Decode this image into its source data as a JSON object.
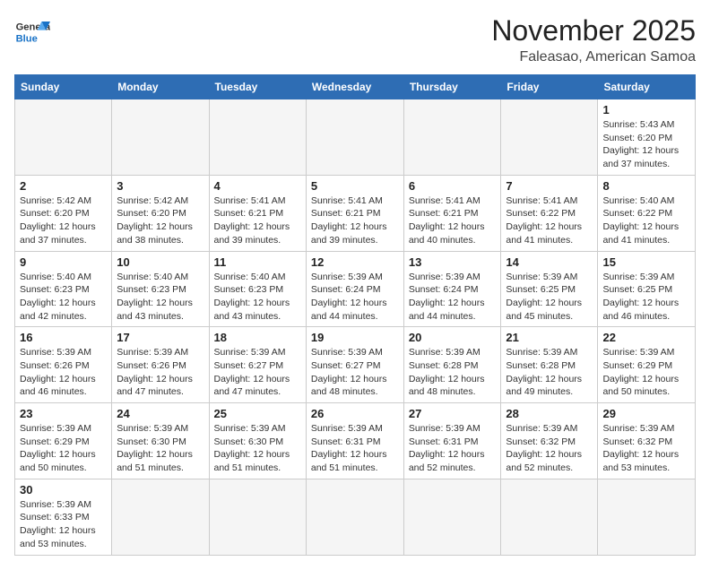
{
  "header": {
    "logo_line1": "General",
    "logo_line2": "Blue",
    "month": "November 2025",
    "location": "Faleasao, American Samoa"
  },
  "weekdays": [
    "Sunday",
    "Monday",
    "Tuesday",
    "Wednesday",
    "Thursday",
    "Friday",
    "Saturday"
  ],
  "weeks": [
    [
      {
        "day": "",
        "info": ""
      },
      {
        "day": "",
        "info": ""
      },
      {
        "day": "",
        "info": ""
      },
      {
        "day": "",
        "info": ""
      },
      {
        "day": "",
        "info": ""
      },
      {
        "day": "",
        "info": ""
      },
      {
        "day": "1",
        "info": "Sunrise: 5:43 AM\nSunset: 6:20 PM\nDaylight: 12 hours and 37 minutes."
      }
    ],
    [
      {
        "day": "2",
        "info": "Sunrise: 5:42 AM\nSunset: 6:20 PM\nDaylight: 12 hours and 37 minutes."
      },
      {
        "day": "3",
        "info": "Sunrise: 5:42 AM\nSunset: 6:20 PM\nDaylight: 12 hours and 38 minutes."
      },
      {
        "day": "4",
        "info": "Sunrise: 5:41 AM\nSunset: 6:21 PM\nDaylight: 12 hours and 39 minutes."
      },
      {
        "day": "5",
        "info": "Sunrise: 5:41 AM\nSunset: 6:21 PM\nDaylight: 12 hours and 39 minutes."
      },
      {
        "day": "6",
        "info": "Sunrise: 5:41 AM\nSunset: 6:21 PM\nDaylight: 12 hours and 40 minutes."
      },
      {
        "day": "7",
        "info": "Sunrise: 5:41 AM\nSunset: 6:22 PM\nDaylight: 12 hours and 41 minutes."
      },
      {
        "day": "8",
        "info": "Sunrise: 5:40 AM\nSunset: 6:22 PM\nDaylight: 12 hours and 41 minutes."
      }
    ],
    [
      {
        "day": "9",
        "info": "Sunrise: 5:40 AM\nSunset: 6:23 PM\nDaylight: 12 hours and 42 minutes."
      },
      {
        "day": "10",
        "info": "Sunrise: 5:40 AM\nSunset: 6:23 PM\nDaylight: 12 hours and 43 minutes."
      },
      {
        "day": "11",
        "info": "Sunrise: 5:40 AM\nSunset: 6:23 PM\nDaylight: 12 hours and 43 minutes."
      },
      {
        "day": "12",
        "info": "Sunrise: 5:39 AM\nSunset: 6:24 PM\nDaylight: 12 hours and 44 minutes."
      },
      {
        "day": "13",
        "info": "Sunrise: 5:39 AM\nSunset: 6:24 PM\nDaylight: 12 hours and 44 minutes."
      },
      {
        "day": "14",
        "info": "Sunrise: 5:39 AM\nSunset: 6:25 PM\nDaylight: 12 hours and 45 minutes."
      },
      {
        "day": "15",
        "info": "Sunrise: 5:39 AM\nSunset: 6:25 PM\nDaylight: 12 hours and 46 minutes."
      }
    ],
    [
      {
        "day": "16",
        "info": "Sunrise: 5:39 AM\nSunset: 6:26 PM\nDaylight: 12 hours and 46 minutes."
      },
      {
        "day": "17",
        "info": "Sunrise: 5:39 AM\nSunset: 6:26 PM\nDaylight: 12 hours and 47 minutes."
      },
      {
        "day": "18",
        "info": "Sunrise: 5:39 AM\nSunset: 6:27 PM\nDaylight: 12 hours and 47 minutes."
      },
      {
        "day": "19",
        "info": "Sunrise: 5:39 AM\nSunset: 6:27 PM\nDaylight: 12 hours and 48 minutes."
      },
      {
        "day": "20",
        "info": "Sunrise: 5:39 AM\nSunset: 6:28 PM\nDaylight: 12 hours and 48 minutes."
      },
      {
        "day": "21",
        "info": "Sunrise: 5:39 AM\nSunset: 6:28 PM\nDaylight: 12 hours and 49 minutes."
      },
      {
        "day": "22",
        "info": "Sunrise: 5:39 AM\nSunset: 6:29 PM\nDaylight: 12 hours and 50 minutes."
      }
    ],
    [
      {
        "day": "23",
        "info": "Sunrise: 5:39 AM\nSunset: 6:29 PM\nDaylight: 12 hours and 50 minutes."
      },
      {
        "day": "24",
        "info": "Sunrise: 5:39 AM\nSunset: 6:30 PM\nDaylight: 12 hours and 51 minutes."
      },
      {
        "day": "25",
        "info": "Sunrise: 5:39 AM\nSunset: 6:30 PM\nDaylight: 12 hours and 51 minutes."
      },
      {
        "day": "26",
        "info": "Sunrise: 5:39 AM\nSunset: 6:31 PM\nDaylight: 12 hours and 51 minutes."
      },
      {
        "day": "27",
        "info": "Sunrise: 5:39 AM\nSunset: 6:31 PM\nDaylight: 12 hours and 52 minutes."
      },
      {
        "day": "28",
        "info": "Sunrise: 5:39 AM\nSunset: 6:32 PM\nDaylight: 12 hours and 52 minutes."
      },
      {
        "day": "29",
        "info": "Sunrise: 5:39 AM\nSunset: 6:32 PM\nDaylight: 12 hours and 53 minutes."
      }
    ],
    [
      {
        "day": "30",
        "info": "Sunrise: 5:39 AM\nSunset: 6:33 PM\nDaylight: 12 hours and 53 minutes."
      },
      {
        "day": "",
        "info": ""
      },
      {
        "day": "",
        "info": ""
      },
      {
        "day": "",
        "info": ""
      },
      {
        "day": "",
        "info": ""
      },
      {
        "day": "",
        "info": ""
      },
      {
        "day": "",
        "info": ""
      }
    ]
  ]
}
